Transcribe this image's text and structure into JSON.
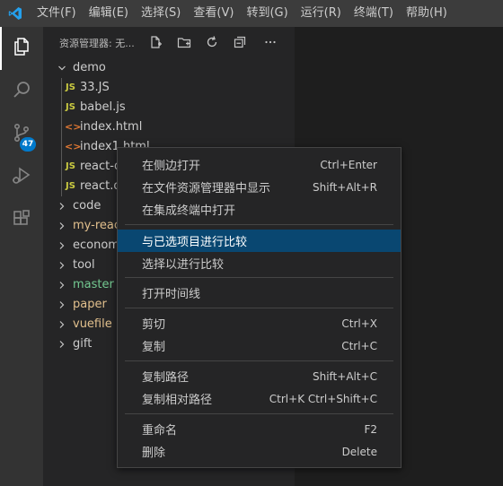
{
  "menubar": {
    "items": [
      "文件(F)",
      "编辑(E)",
      "选择(S)",
      "查看(V)",
      "转到(G)",
      "运行(R)",
      "终端(T)",
      "帮助(H)"
    ]
  },
  "activitybar": {
    "items": [
      "files-icon",
      "search-icon",
      "source-control-icon",
      "run-debug-icon",
      "extensions-icon"
    ],
    "scm_badge": "47"
  },
  "sidebar": {
    "title": "资源管理器: 无...",
    "tree": [
      {
        "label": "demo",
        "kind": "folder-open"
      },
      {
        "label": "33.JS",
        "kind": "js"
      },
      {
        "label": "babel.js",
        "kind": "js"
      },
      {
        "label": "index.html",
        "kind": "html"
      },
      {
        "label": "index1.html",
        "kind": "html"
      },
      {
        "label": "react-d",
        "kind": "js"
      },
      {
        "label": "react.de",
        "kind": "js"
      },
      {
        "label": "code",
        "kind": "folder"
      },
      {
        "label": "my-react",
        "kind": "folder"
      },
      {
        "label": "economy",
        "kind": "folder"
      },
      {
        "label": "tool",
        "kind": "folder"
      },
      {
        "label": "master",
        "kind": "folder"
      },
      {
        "label": "paper",
        "kind": "folder"
      },
      {
        "label": "vuefile",
        "kind": "folder"
      },
      {
        "label": "gift",
        "kind": "folder"
      }
    ]
  },
  "context_menu": {
    "groups": [
      [
        {
          "label": "在侧边打开",
          "shortcut": "Ctrl+Enter"
        },
        {
          "label": "在文件资源管理器中显示",
          "shortcut": "Shift+Alt+R"
        },
        {
          "label": "在集成终端中打开",
          "shortcut": ""
        }
      ],
      [
        {
          "label": "与已选项目进行比较",
          "shortcut": "",
          "selected": true
        },
        {
          "label": "选择以进行比较",
          "shortcut": ""
        }
      ],
      [
        {
          "label": "打开时间线",
          "shortcut": ""
        }
      ],
      [
        {
          "label": "剪切",
          "shortcut": "Ctrl+X"
        },
        {
          "label": "复制",
          "shortcut": "Ctrl+C"
        }
      ],
      [
        {
          "label": "复制路径",
          "shortcut": "Shift+Alt+C"
        },
        {
          "label": "复制相对路径",
          "shortcut": "Ctrl+K Ctrl+Shift+C"
        }
      ],
      [
        {
          "label": "重命名",
          "shortcut": "F2"
        },
        {
          "label": "删除",
          "shortcut": "Delete"
        }
      ]
    ]
  },
  "colors": {
    "accent": "#007acc",
    "menu_selection": "#094771",
    "git_modified": "#e2c08d",
    "git_added": "#73c991"
  }
}
